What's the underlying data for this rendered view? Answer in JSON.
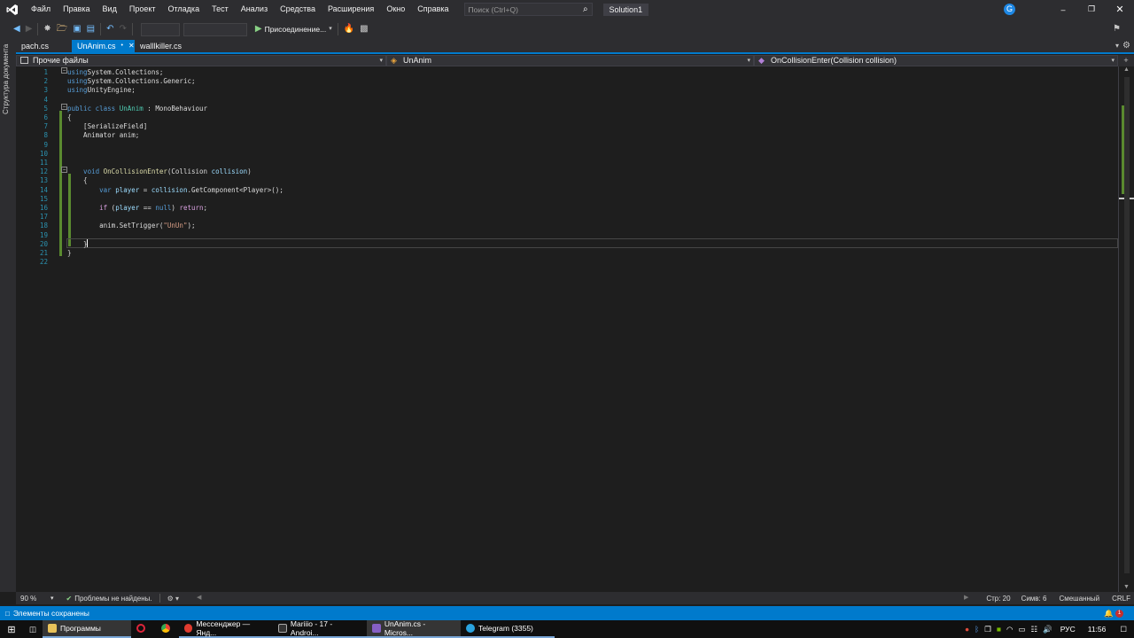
{
  "menubar": {
    "items": [
      "Файл",
      "Правка",
      "Вид",
      "Проект",
      "Отладка",
      "Тест",
      "Анализ",
      "Средства",
      "Расширения",
      "Окно",
      "Справка"
    ],
    "search_placeholder": "Поиск (Ctrl+Q)",
    "solution": "Solution1",
    "avatar_letter": "G"
  },
  "toolbar": {
    "attach_label": "Присоединение..."
  },
  "left_panel": {
    "label": "Структура документа"
  },
  "tabs": [
    {
      "label": "pach.cs",
      "active": false
    },
    {
      "label": "UnAnim.cs",
      "active": true
    },
    {
      "label": "walllkiller.cs",
      "active": false
    }
  ],
  "navbar": {
    "project": "Прочие файлы",
    "class": "UnAnim",
    "member": "OnCollisionEnter(Collision collision)"
  },
  "code": {
    "line_numbers": [
      "1",
      "2",
      "3",
      "4",
      "5",
      "6",
      "7",
      "8",
      "9",
      "10",
      "11",
      "12",
      "13",
      "14",
      "15",
      "16",
      "17",
      "18",
      "19",
      "20",
      "21",
      "22"
    ],
    "lines": [
      [
        [
          "k",
          "using"
        ],
        [
          "",
          "System.Collections;"
        ]
      ],
      [
        [
          "k",
          "using"
        ],
        [
          "",
          "System.Collections.Generic;"
        ]
      ],
      [
        [
          "k",
          "using"
        ],
        [
          "",
          "UnityEngine;"
        ]
      ],
      [],
      [
        [
          "k",
          "public class "
        ],
        [
          "t",
          "UnAnim"
        ],
        [
          "",
          " : MonoBehaviour"
        ]
      ],
      [
        [
          "",
          "{"
        ]
      ],
      [
        [
          "",
          "    [SerializeField]"
        ]
      ],
      [
        [
          "",
          "    Animator anim;"
        ]
      ],
      [],
      [],
      [],
      [
        [
          "k",
          "    void "
        ],
        [
          "m",
          "OnCollisionEnter"
        ],
        [
          "",
          "(Collision "
        ],
        [
          "p",
          "collision"
        ],
        [
          "",
          ")"
        ]
      ],
      [
        [
          "",
          "    {"
        ]
      ],
      [
        [
          "k",
          "        var "
        ],
        [
          "p",
          "player"
        ],
        [
          "",
          " = "
        ],
        [
          "p",
          "collision"
        ],
        [
          "",
          ".GetComponent<Player>();"
        ]
      ],
      [],
      [
        [
          "kc",
          "        if"
        ],
        [
          "",
          " ("
        ],
        [
          "p",
          "player"
        ],
        [
          "",
          " == "
        ],
        [
          "k",
          "null"
        ],
        [
          "",
          ") "
        ],
        [
          "kc",
          "return"
        ],
        [
          "",
          ";"
        ]
      ],
      [],
      [
        [
          "",
          "        anim.SetTrigger("
        ],
        [
          "s",
          "\"UnUn\""
        ],
        [
          "",
          ");"
        ]
      ],
      [],
      [
        [
          "",
          "    }"
        ]
      ],
      [
        [
          "",
          "}"
        ]
      ],
      []
    ]
  },
  "status": {
    "zoom": "90 %",
    "problems": "Проблемы не найдены.",
    "line": "Стр: 20",
    "col": "Симв: 6",
    "indent": "Смешанный",
    "eol": "CRLF",
    "saved": "Элементы сохранены",
    "notif_count": "1"
  },
  "taskbar": {
    "items": [
      "Программы",
      "Мессенджер — Янд...",
      "Mariiio - 17 - Androi...",
      "UnAnim.cs - Micros...",
      "Telegram (3355)"
    ],
    "lang": "РУС",
    "time": "11:56"
  }
}
